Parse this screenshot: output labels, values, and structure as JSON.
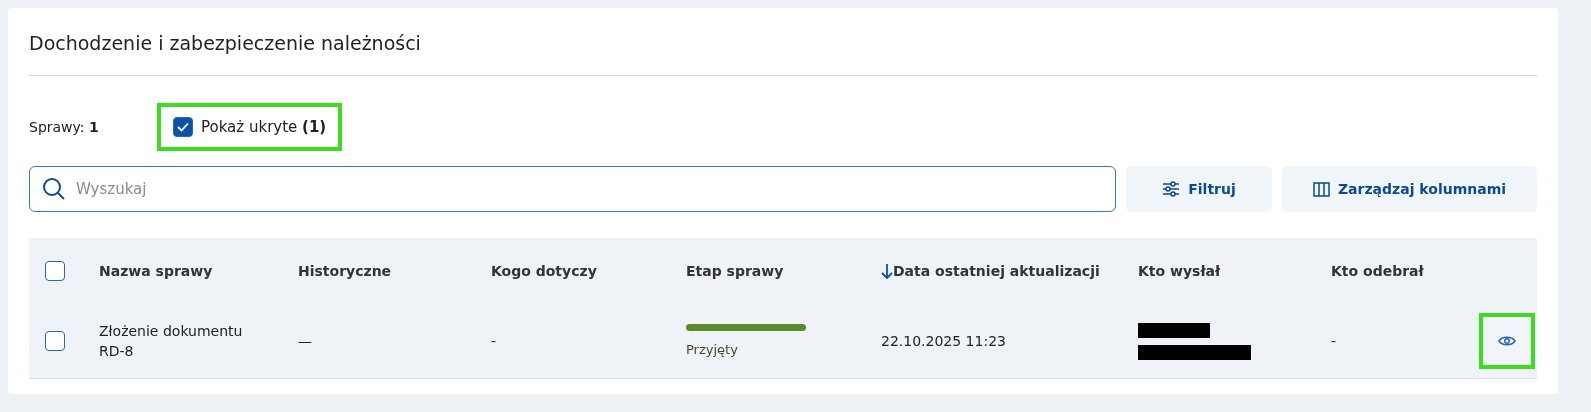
{
  "title": "Dochodzenie i zabezpieczenie należności",
  "summary": {
    "label": "Sprawy:",
    "count": "1"
  },
  "show_hidden": {
    "label": "Pokaż ukryte",
    "count": "(1)",
    "checked": true,
    "highlighted": true
  },
  "search": {
    "placeholder": "Wyszukaj"
  },
  "buttons": [
    {
      "kind": "filter",
      "label": "Filtruj"
    },
    {
      "kind": "columns",
      "label": "Zarządzaj kolumnami"
    }
  ],
  "table": {
    "select_all": {
      "checked": false
    },
    "columns": [
      {
        "label": "Nazwa sprawy",
        "sorted": false
      },
      {
        "label": "Historyczne",
        "sorted": false
      },
      {
        "label": "Kogo dotyczy",
        "sorted": false
      },
      {
        "label": "Etap sprawy",
        "sorted": false
      },
      {
        "label": "Data ostatniej aktualizacji",
        "sorted": true
      },
      {
        "label": "Kto wysłał",
        "sorted": false
      },
      {
        "label": "Kto odebrał",
        "sorted": false
      }
    ],
    "rows": [
      {
        "checked": false,
        "name": "Złożenie dokumentu RD-8",
        "historical": "—",
        "concerns": "-",
        "stage": {
          "label": "Przyjęty",
          "color": "#5e8a2e"
        },
        "updated": "22.10.2025 11:23",
        "sender_redacted": true,
        "receiver": "-",
        "view_highlighted": true
      }
    ]
  }
}
